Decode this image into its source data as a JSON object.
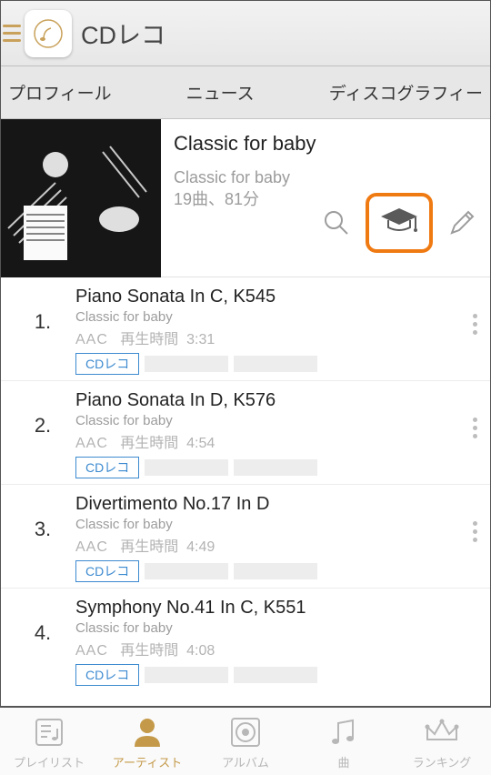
{
  "app": {
    "title": "CDレコ"
  },
  "segTabs": [
    "プロフィール",
    "ニュース",
    "ディスコグラフィー"
  ],
  "album": {
    "title": "Classic for baby",
    "artist": "Classic for baby",
    "meta": "19曲、81分"
  },
  "tracks": [
    {
      "n": "1.",
      "title": "Piano Sonata In C, K545",
      "artist": "Classic for baby",
      "fmt": "AAC",
      "durLabel": "再生時間",
      "dur": "3:31",
      "badge": "CDレコ"
    },
    {
      "n": "2.",
      "title": "Piano Sonata In D, K576",
      "artist": "Classic for baby",
      "fmt": "AAC",
      "durLabel": "再生時間",
      "dur": "4:54",
      "badge": "CDレコ"
    },
    {
      "n": "3.",
      "title": "Divertimento No.17 In D",
      "artist": "Classic for baby",
      "fmt": "AAC",
      "durLabel": "再生時間",
      "dur": "4:49",
      "badge": "CDレコ"
    },
    {
      "n": "4.",
      "title": "Symphony No.41 In C, K551",
      "artist": "Classic for baby",
      "fmt": "AAC",
      "durLabel": "再生時間",
      "dur": "4:08",
      "badge": "CDレコ"
    }
  ],
  "bottomTabs": [
    {
      "label": "プレイリスト"
    },
    {
      "label": "アーティスト"
    },
    {
      "label": "アルバム"
    },
    {
      "label": "曲"
    },
    {
      "label": "ランキング"
    }
  ]
}
